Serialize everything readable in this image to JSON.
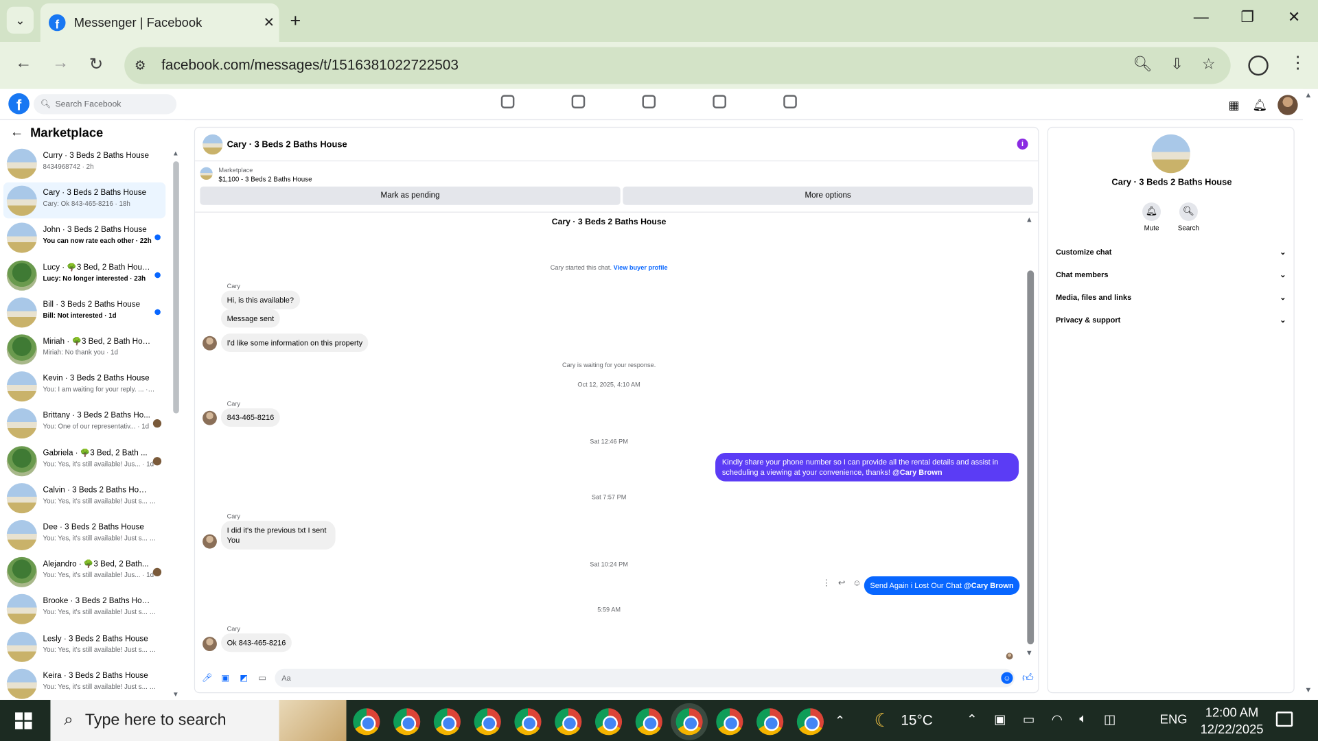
{
  "browser": {
    "tab_title": "Messenger | Facebook",
    "url": "facebook.com/messages/t/1516381022722503"
  },
  "fb": {
    "search_placeholder": "Search Facebook"
  },
  "left": {
    "title": "Marketplace",
    "conversations": [
      {
        "name": "Curry · 3 Beds 2 Baths House",
        "sub": "8434968742 · 2h",
        "thumb": "house",
        "unread": false,
        "indicator": "none"
      },
      {
        "name": "Cary · 3 Beds 2 Baths House",
        "sub": "Cary: Ok 843-465-8216 · 18h",
        "thumb": "house",
        "unread": false,
        "indicator": "none",
        "active": true
      },
      {
        "name": "John · 3 Beds 2 Baths House",
        "sub": "You can now rate each other · 22h",
        "thumb": "house",
        "unread": true,
        "indicator": "dot"
      },
      {
        "name": "Lucy · 🌳3 Bed, 2 Bath Hous...",
        "sub": "Lucy: No longer interested · 23h",
        "thumb": "tree",
        "unread": true,
        "indicator": "dot"
      },
      {
        "name": "Bill · 3 Beds 2 Baths House",
        "sub": "Bill: Not interested · 1d",
        "thumb": "house",
        "unread": true,
        "indicator": "dot"
      },
      {
        "name": "Miriah · 🌳3 Bed, 2 Bath Hous...",
        "sub": "Miriah: No thank you · 1d",
        "thumb": "tree",
        "unread": false,
        "indicator": "none"
      },
      {
        "name": "Kevin · 3 Beds 2 Baths House",
        "sub": "You: I am waiting for your reply. ... · 1d",
        "thumb": "house",
        "unread": false,
        "indicator": "none"
      },
      {
        "name": "Brittany · 3 Beds 2 Baths Ho...",
        "sub": "You: One of our representativ... · 1d",
        "thumb": "house",
        "unread": false,
        "indicator": "avatar"
      },
      {
        "name": "Gabriela · 🌳3 Bed, 2 Bath ...",
        "sub": "You: Yes, it's still available! Jus... · 1d",
        "thumb": "tree",
        "unread": false,
        "indicator": "avatar"
      },
      {
        "name": "Calvin · 3 Beds 2 Baths House",
        "sub": "You: Yes, it's still available! Just s... · 1d",
        "thumb": "house",
        "unread": false,
        "indicator": "none"
      },
      {
        "name": "Dee · 3 Beds 2 Baths House",
        "sub": "You: Yes, it's still available! Just s... · 1d",
        "thumb": "house",
        "unread": false,
        "indicator": "none"
      },
      {
        "name": "Alejandro · 🌳3 Bed, 2 Bath...",
        "sub": "You: Yes, it's still available! Jus... · 1d",
        "thumb": "tree",
        "unread": false,
        "indicator": "avatar"
      },
      {
        "name": "Brooke · 3 Beds 2 Baths House",
        "sub": "You: Yes, it's still available! Just s... · 1d",
        "thumb": "house",
        "unread": false,
        "indicator": "none"
      },
      {
        "name": "Lesly · 3 Beds 2 Baths House",
        "sub": "You: Yes, it's still available! Just s... · 1d",
        "thumb": "house",
        "unread": false,
        "indicator": "none"
      },
      {
        "name": "Keira · 3 Beds 2 Baths House",
        "sub": "You: Yes, it's still available! Just s... · 1d",
        "thumb": "house",
        "unread": false,
        "indicator": "none"
      }
    ]
  },
  "chat": {
    "title": "Cary · 3 Beds 2 Baths House",
    "marketplace_label": "Marketplace",
    "listing": "$1,100 - 3 Beds 2 Baths House",
    "mark_pending": "Mark as pending",
    "more_options": "More options",
    "listing_title": "Cary · 3 Beds 2 Baths House",
    "started_text": "Cary started this chat.",
    "view_profile": "View buyer profile",
    "sender": "Cary",
    "m1": "Hi, is this available?",
    "m2": "Message sent",
    "m3": "I'd like some information on this property",
    "waiting": "Cary is waiting for your response.",
    "t1": "Oct 12, 2025, 4:10 AM",
    "m4": "843-465-8216",
    "t2": "Sat 12:46 PM",
    "o1": "Kindly share your phone number so I can provide all the rental details and assist in scheduling a viewing at your convenience, thanks!",
    "o1_mention": "@Cary Brown",
    "t3": "Sat 7:57 PM",
    "m5a": "I did it's the previous txt I sent",
    "m5b": "You",
    "t4": "Sat 10:24 PM",
    "o2": "Send Again i Lost Our Chat",
    "o2_mention": "@Cary Brown",
    "t5": "5:59 AM",
    "m6": "Ok 843-465-8216",
    "composer_placeholder": "Aa"
  },
  "details": {
    "name": "Cary · 3 Beds 2 Baths House",
    "mute": "Mute",
    "search": "Search",
    "sections": [
      "Customize chat",
      "Chat members",
      "Media, files and links",
      "Privacy & support"
    ]
  },
  "taskbar": {
    "search_placeholder": "Type here to search",
    "temp": "15°C",
    "lang": "ENG",
    "time": "12:00 AM",
    "date": "12/22/2025",
    "app_count": 12
  }
}
